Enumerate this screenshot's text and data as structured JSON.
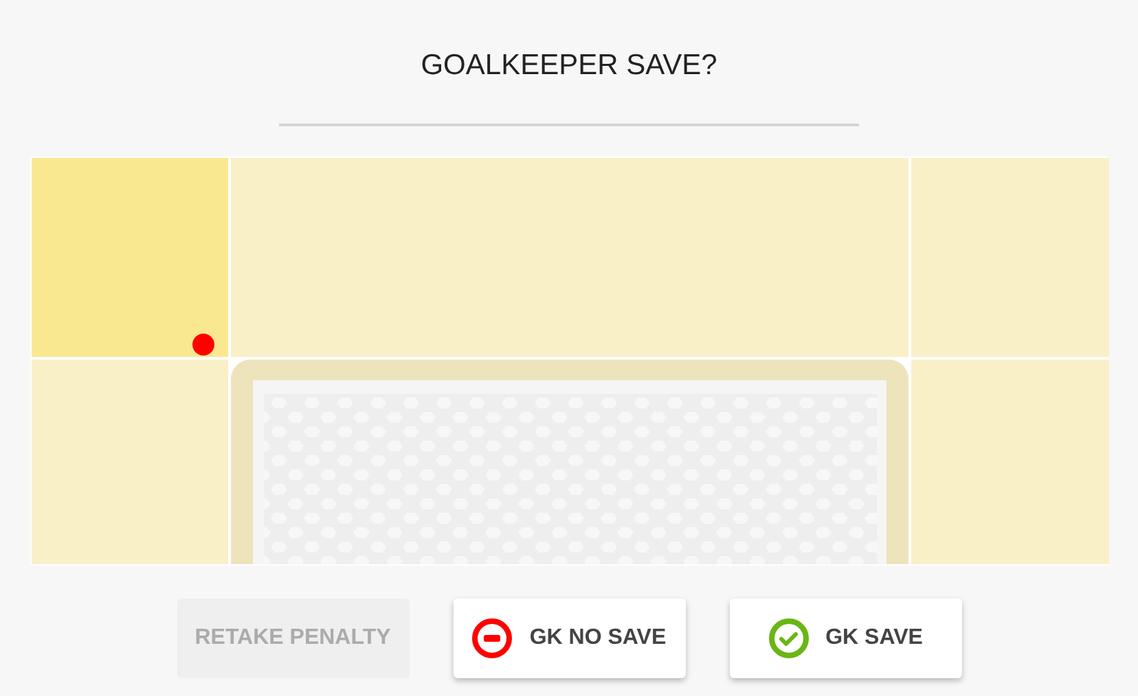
{
  "title": "GOALKEEPER SAVE?",
  "zones": [
    {
      "selected": true,
      "ball": true
    },
    {
      "selected": false,
      "ball": false
    },
    {
      "selected": false,
      "ball": false
    },
    {
      "selected": false,
      "ball": false
    },
    {
      "selected": false,
      "ball": false
    }
  ],
  "buttons": [
    {
      "label": "RETAKE PENALTY",
      "kind": "plain",
      "disabled": true
    },
    {
      "label": "GK NO SAVE",
      "kind": "no-save",
      "disabled": false
    },
    {
      "label": "GK SAVE",
      "kind": "save",
      "disabled": false
    }
  ]
}
